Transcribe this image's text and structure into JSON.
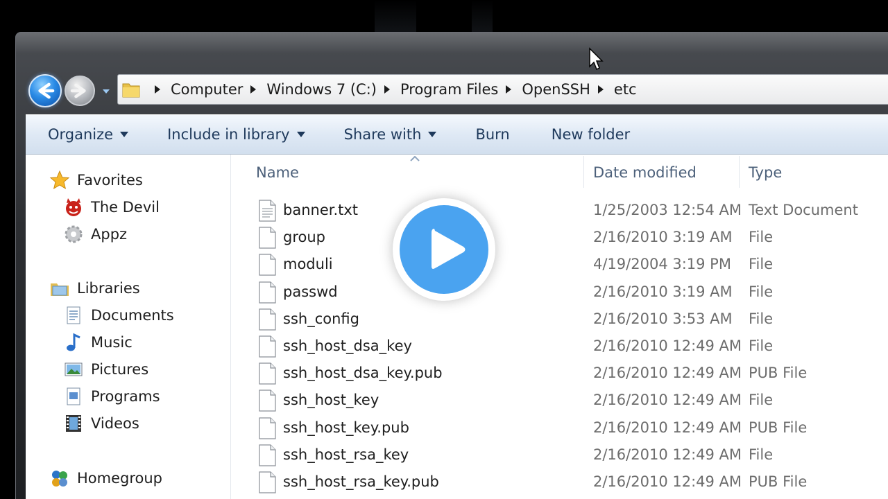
{
  "navigation": {
    "back_icon": "back-arrow-icon",
    "forward_icon": "forward-arrow-icon",
    "history_icon": "chevron-down-icon"
  },
  "address_bar": {
    "icon": "folder-icon",
    "breadcrumbs": [
      "Computer",
      "Windows 7 (C:)",
      "Program Files",
      "OpenSSH",
      "etc"
    ]
  },
  "command_bar": {
    "organize": "Organize",
    "include_in_library": "Include in library",
    "share_with": "Share with",
    "burn": "Burn",
    "new_folder": "New folder"
  },
  "nav_pane": {
    "favorites": {
      "label": "Favorites",
      "items": [
        {
          "label": "The Devil",
          "icon": "devil-icon"
        },
        {
          "label": "Appz",
          "icon": "gear-icon"
        }
      ]
    },
    "libraries": {
      "label": "Libraries",
      "items": [
        {
          "label": "Documents",
          "icon": "document-icon"
        },
        {
          "label": "Music",
          "icon": "music-note-icon"
        },
        {
          "label": "Pictures",
          "icon": "picture-icon"
        },
        {
          "label": "Programs",
          "icon": "program-icon"
        },
        {
          "label": "Videos",
          "icon": "film-icon"
        }
      ]
    },
    "homegroup": {
      "label": "Homegroup",
      "icon": "homegroup-icon"
    }
  },
  "file_list": {
    "columns": {
      "name": "Name",
      "date_modified": "Date modified",
      "type": "Type"
    },
    "rows": [
      {
        "name": "banner.txt",
        "date": "1/25/2003 12:54 AM",
        "type": "Text Document"
      },
      {
        "name": "group",
        "date": "2/16/2010 3:19 AM",
        "type": "File"
      },
      {
        "name": "moduli",
        "date": "4/19/2004 3:19 PM",
        "type": "File"
      },
      {
        "name": "passwd",
        "date": "2/16/2010 3:19 AM",
        "type": "File"
      },
      {
        "name": "ssh_config",
        "date": "2/16/2010 3:53 AM",
        "type": "File"
      },
      {
        "name": "ssh_host_dsa_key",
        "date": "2/16/2010 12:49 AM",
        "type": "File"
      },
      {
        "name": "ssh_host_dsa_key.pub",
        "date": "2/16/2010 12:49 AM",
        "type": "PUB File"
      },
      {
        "name": "ssh_host_key",
        "date": "2/16/2010 12:49 AM",
        "type": "File"
      },
      {
        "name": "ssh_host_key.pub",
        "date": "2/16/2010 12:49 AM",
        "type": "PUB File"
      },
      {
        "name": "ssh_host_rsa_key",
        "date": "2/16/2010 12:49 AM",
        "type": "File"
      },
      {
        "name": "ssh_host_rsa_key.pub",
        "date": "2/16/2010 12:49 AM",
        "type": "PUB File"
      }
    ]
  },
  "overlay": {
    "icon": "play-icon",
    "color": "#4aa3f0"
  },
  "colors": {
    "accent": "#1e395b",
    "header_text": "#4c607a",
    "meta_text": "#6d6d6d"
  }
}
